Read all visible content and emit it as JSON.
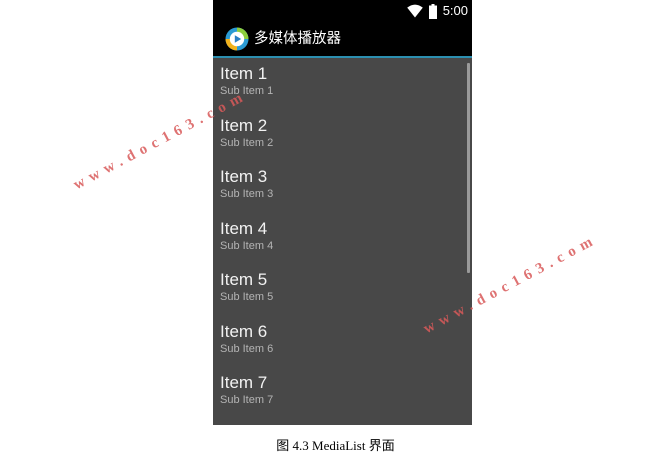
{
  "status_bar": {
    "time": "5:00",
    "icons": [
      "wifi-icon",
      "battery-icon"
    ]
  },
  "action_bar": {
    "app_icon": "media-player-app-icon",
    "title": "多媒体播放器",
    "accent_color": "#2c8fb0"
  },
  "list": {
    "items": [
      {
        "title": "Item 1",
        "subtitle": "Sub Item 1"
      },
      {
        "title": "Item 2",
        "subtitle": "Sub Item 2"
      },
      {
        "title": "Item 3",
        "subtitle": "Sub Item 3"
      },
      {
        "title": "Item 4",
        "subtitle": "Sub Item 4"
      },
      {
        "title": "Item 5",
        "subtitle": "Sub Item 5"
      },
      {
        "title": "Item 6",
        "subtitle": "Sub Item 6"
      },
      {
        "title": "Item 7",
        "subtitle": "Sub Item 7"
      }
    ]
  },
  "watermarks": [
    "www.doc163.com",
    "www.doc163.com"
  ],
  "caption": "图 4.3 MediaList 界面"
}
